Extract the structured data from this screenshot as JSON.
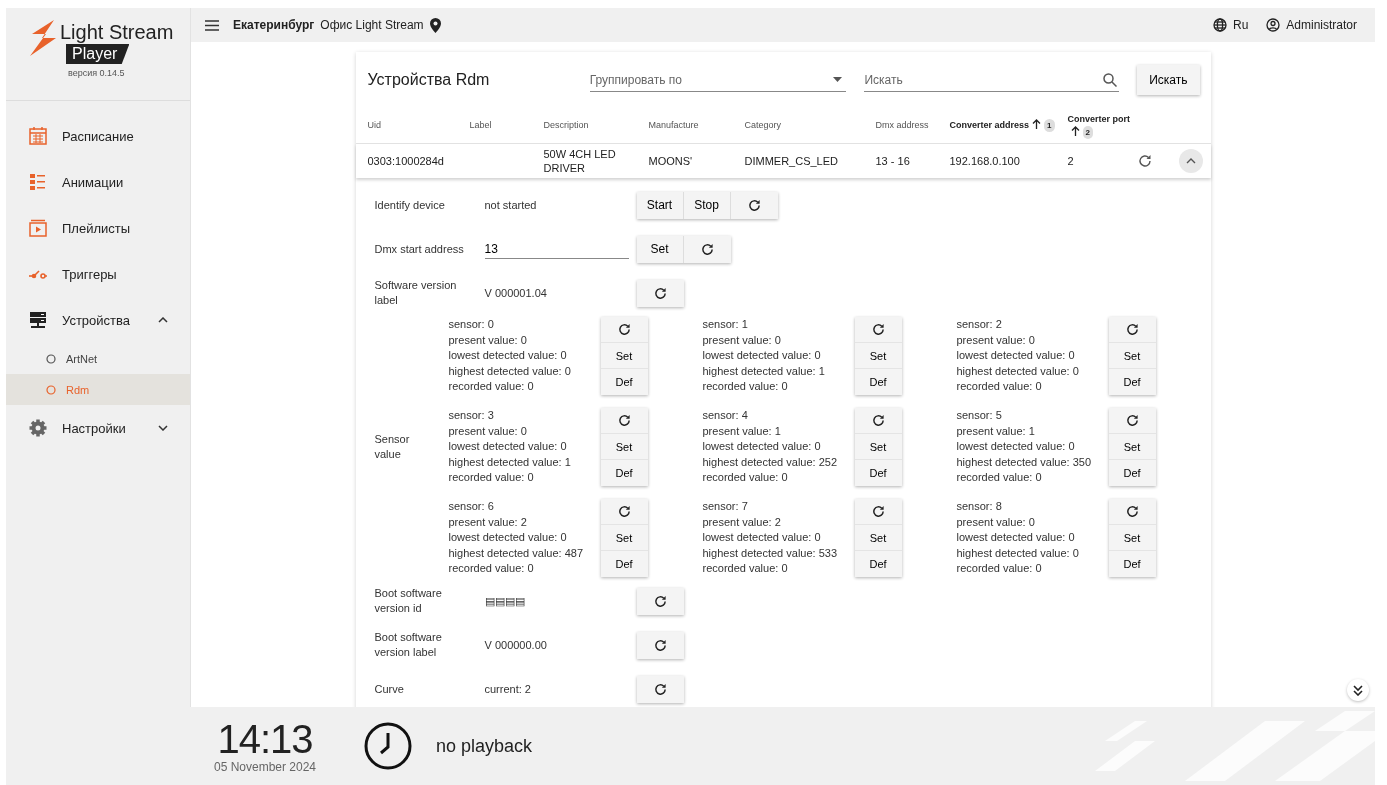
{
  "brand": {
    "name": "Light Stream",
    "product": "Player",
    "version": "версия 0.14.5"
  },
  "sidebar": {
    "items": [
      {
        "label": "Расписание"
      },
      {
        "label": "Анимации"
      },
      {
        "label": "Плейлисты"
      },
      {
        "label": "Триггеры"
      },
      {
        "label": "Устройства",
        "expanded": true,
        "children": [
          {
            "label": "ArtNet",
            "selected": false
          },
          {
            "label": "Rdm",
            "selected": true
          }
        ]
      },
      {
        "label": "Настройки",
        "expanded": false
      }
    ]
  },
  "topbar": {
    "city": "Екатеринбург",
    "office": "Офис Light Stream",
    "language": "Ru",
    "user": "Administrator"
  },
  "panel": {
    "title": "Устройства Rdm",
    "group_by": {
      "placeholder": "Группировать по"
    },
    "search": {
      "placeholder": "Искать"
    },
    "search_button": "Искать"
  },
  "table": {
    "columns": [
      {
        "label": "Uid",
        "sorted": false
      },
      {
        "label": "Label",
        "sorted": false
      },
      {
        "label": "Description",
        "sorted": false
      },
      {
        "label": "Manufacture",
        "sorted": false
      },
      {
        "label": "Category",
        "sorted": false
      },
      {
        "label": "Dmx address",
        "sorted": false
      },
      {
        "label": "Converter address",
        "sorted": true,
        "sort_order": "1"
      },
      {
        "label": "Converter port",
        "sorted": true,
        "sort_order": "2"
      }
    ],
    "rows": [
      {
        "cells": [
          "0303:1000284d",
          "",
          "50W 4CH LED DRIVER",
          "MOONS'",
          "DIMMER_CS_LED",
          "13 - 16",
          "192.168.0.100",
          "2"
        ],
        "expanded": true
      }
    ]
  },
  "details": [
    {
      "kind": "status",
      "label": "Identify device",
      "value": "not started",
      "buttons": [
        "Start",
        "Stop"
      ]
    },
    {
      "kind": "input",
      "label": "Dmx start address",
      "value": "13",
      "buttons": [
        "Set"
      ]
    },
    {
      "kind": "value",
      "label": "Software version label",
      "value": "V 000001.04"
    },
    {
      "kind": "sensors",
      "label": "Sensor value",
      "sensors": [
        {
          "lines": [
            "sensor: 0",
            "present value: 0",
            "lowest detected value: 0",
            "highest detected value: 0",
            "recorded value: 0"
          ],
          "buttons": [
            "Set",
            "Def"
          ]
        },
        {
          "lines": [
            "sensor: 1",
            "present value: 0",
            "lowest detected value: 0",
            "highest detected value: 1",
            "recorded value: 0"
          ],
          "buttons": [
            "Set",
            "Def"
          ]
        },
        {
          "lines": [
            "sensor: 2",
            "present value: 0",
            "lowest detected value: 0",
            "highest detected value: 0",
            "recorded value: 0"
          ],
          "buttons": [
            "Set",
            "Def"
          ]
        },
        {
          "lines": [
            "sensor: 3",
            "present value: 0",
            "lowest detected value: 0",
            "highest detected value: 1",
            "recorded value: 0"
          ],
          "buttons": [
            "Set",
            "Def"
          ]
        },
        {
          "lines": [
            "sensor: 4",
            "present value: 1",
            "lowest detected value: 0",
            "highest detected value: 252",
            "recorded value: 0"
          ],
          "buttons": [
            "Set",
            "Def"
          ]
        },
        {
          "lines": [
            "sensor: 5",
            "present value: 1",
            "lowest detected value: 0",
            "highest detected value: 350",
            "recorded value: 0"
          ],
          "buttons": [
            "Set",
            "Def"
          ]
        },
        {
          "lines": [
            "sensor: 6",
            "present value: 2",
            "lowest detected value: 0",
            "highest detected value: 487",
            "recorded value: 0"
          ],
          "buttons": [
            "Set",
            "Def"
          ]
        },
        {
          "lines": [
            "sensor: 7",
            "present value: 2",
            "lowest detected value: 0",
            "highest detected value: 533",
            "recorded value: 0"
          ],
          "buttons": [
            "Set",
            "Def"
          ]
        },
        {
          "lines": [
            "sensor: 8",
            "present value: 0",
            "lowest detected value: 0",
            "highest detected value: 0",
            "recorded value: 0"
          ],
          "buttons": [
            "Set",
            "Def"
          ]
        }
      ]
    },
    {
      "kind": "value",
      "label": "Boot software version id",
      "value": "▤▤▤▤"
    },
    {
      "kind": "value",
      "label": "Boot software version label",
      "value": "V 000000.00"
    },
    {
      "kind": "value",
      "label": "Curve",
      "value": "current: 2"
    }
  ],
  "footer": {
    "time": "14:13",
    "date": "05 November 2024",
    "playback": "no playback"
  }
}
